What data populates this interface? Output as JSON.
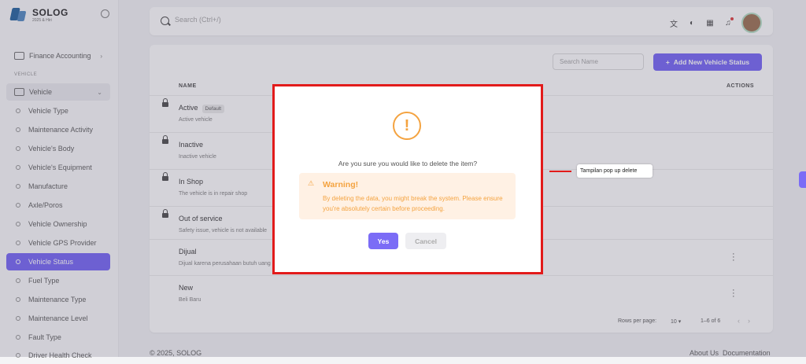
{
  "app": {
    "name": "SOLOG",
    "tagline": "2025 & Hiri"
  },
  "sidebar": {
    "finance": "Finance Accounting",
    "section": "VEHICLE",
    "group": "Vehicle",
    "items": [
      {
        "label": "Vehicle Type"
      },
      {
        "label": "Maintenance Activity"
      },
      {
        "label": "Vehicle's Body"
      },
      {
        "label": "Vehicle's Equipment"
      },
      {
        "label": "Manufacture"
      },
      {
        "label": "Axle/Poros"
      },
      {
        "label": "Vehicle Ownership"
      },
      {
        "label": "Vehicle GPS Provider"
      },
      {
        "label": "Vehicle Status"
      },
      {
        "label": "Fuel Type"
      },
      {
        "label": "Maintenance Type"
      },
      {
        "label": "Maintenance Level"
      },
      {
        "label": "Fault Type"
      },
      {
        "label": "Driver Health Check"
      }
    ],
    "active_item": "Vehicle Status"
  },
  "topbar": {
    "search_placeholder": "Search (Ctrl+/)"
  },
  "card": {
    "search_placeholder": "Search Name",
    "add_button": "Add New Vehicle Status",
    "col_name": "NAME",
    "col_actions": "ACTIONS",
    "rows": [
      {
        "name": "Active",
        "tag": "Default",
        "desc": "Active vehicle"
      },
      {
        "name": "Inactive",
        "tag": "",
        "desc": "Inactive vehicle"
      },
      {
        "name": "In Shop",
        "tag": "",
        "desc": "The vehicle is in repair shop"
      },
      {
        "name": "Out of service",
        "tag": "",
        "desc": "Safety issue, vehicle is not available"
      },
      {
        "name": "Dijual",
        "tag": "",
        "desc": "Dijual karena perusahaan butuh uang"
      },
      {
        "name": "New",
        "tag": "",
        "desc": "Beli Baru"
      }
    ],
    "rows_per_page_label": "Rows per page:",
    "rows_per_page_value": "10",
    "range": "1–6 of 6"
  },
  "footer": {
    "copyright": "© 2025, SOLOG",
    "about": "About Us",
    "docs": "Documentation"
  },
  "modal": {
    "question": "Are you sure you would like to delete the item?",
    "warning_title": "Warning!",
    "warning_body": "By deleting the data, you might break the system. Please ensure you're absolutely certain before proceeding.",
    "yes": "Yes",
    "cancel": "Cancel"
  },
  "annotation": {
    "label": "Tampilan pop up delete"
  },
  "colors": {
    "accent": "#7b6cf6",
    "warning": "#f4a340",
    "highlight": "#e21b1b"
  }
}
